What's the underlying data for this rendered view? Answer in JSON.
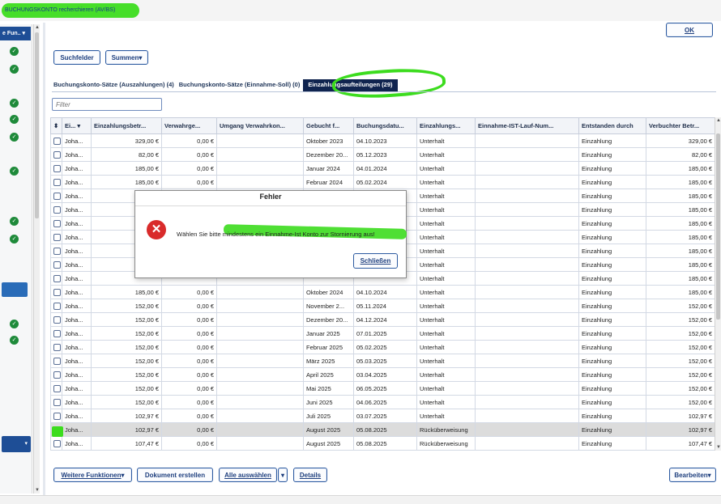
{
  "window": {
    "title": "BUCHUNGSKONTO recherchieren (AV/BS)"
  },
  "left_panel": {
    "header_label": "e Fun.."
  },
  "toolbar": {
    "ok_label": "OK",
    "suchfelder_label": "Suchfelder",
    "summen_label": "Summen"
  },
  "tabs": [
    {
      "label": "Buchungskonto-Sätze (Auszahlungen) (4)"
    },
    {
      "label": "Buchungskonto-Sätze (Einnahme-Soll) (0)"
    },
    {
      "label": "Einzahlungsaufteilungen (29)"
    }
  ],
  "filter": {
    "placeholder": "Filter"
  },
  "table": {
    "columns": [
      "Ei...",
      "Einzahlungsbetr...",
      "Verwahrge...",
      "Umgang Verwahrkon...",
      "Gebucht f...",
      "Buchungsdatu...",
      "Einzahlungs...",
      "Einnahme-IST-Lauf-Num...",
      "Entstanden durch",
      "Verbuchter Betr..."
    ],
    "rows": [
      {
        "checked": false,
        "name": "Joha...",
        "betrag": "329,00 €",
        "verwahr": "0,00 €",
        "umgang": "",
        "gebucht": "Oktober 2023",
        "buchung": "04.10.2023",
        "art": "Unterhalt",
        "lauf": "",
        "entstanden": "Einzahlung",
        "verbucht": "329,00 €"
      },
      {
        "checked": false,
        "name": "Joha...",
        "betrag": "82,00 €",
        "verwahr": "0,00 €",
        "umgang": "",
        "gebucht": "Dezember 20...",
        "buchung": "05.12.2023",
        "art": "Unterhalt",
        "lauf": "",
        "entstanden": "Einzahlung",
        "verbucht": "82,00 €"
      },
      {
        "checked": false,
        "name": "Joha...",
        "betrag": "185,00 €",
        "verwahr": "0,00 €",
        "umgang": "",
        "gebucht": "Januar 2024",
        "buchung": "04.01.2024",
        "art": "Unterhalt",
        "lauf": "",
        "entstanden": "Einzahlung",
        "verbucht": "185,00 €"
      },
      {
        "checked": false,
        "name": "Joha...",
        "betrag": "185,00 €",
        "verwahr": "0,00 €",
        "umgang": "",
        "gebucht": "Februar 2024",
        "buchung": "05.02.2024",
        "art": "Unterhalt",
        "lauf": "",
        "entstanden": "Einzahlung",
        "verbucht": "185,00 €"
      },
      {
        "checked": false,
        "name": "Joha...",
        "betrag": "",
        "verwahr": "",
        "umgang": "",
        "gebucht": "",
        "buchung": "",
        "art": "Unterhalt",
        "lauf": "",
        "entstanden": "Einzahlung",
        "verbucht": "185,00 €"
      },
      {
        "checked": false,
        "name": "Joha...",
        "betrag": "",
        "verwahr": "",
        "umgang": "",
        "gebucht": "",
        "buchung": "",
        "art": "Unterhalt",
        "lauf": "",
        "entstanden": "Einzahlung",
        "verbucht": "185,00 €"
      },
      {
        "checked": false,
        "name": "Joha...",
        "betrag": "",
        "verwahr": "",
        "umgang": "",
        "gebucht": "",
        "buchung": "",
        "art": "Unterhalt",
        "lauf": "",
        "entstanden": "Einzahlung",
        "verbucht": "185,00 €"
      },
      {
        "checked": false,
        "name": "Joha...",
        "betrag": "",
        "verwahr": "",
        "umgang": "",
        "gebucht": "",
        "buchung": "",
        "art": "Unterhalt",
        "lauf": "",
        "entstanden": "Einzahlung",
        "verbucht": "185,00 €"
      },
      {
        "checked": false,
        "name": "Joha...",
        "betrag": "",
        "verwahr": "",
        "umgang": "",
        "gebucht": "",
        "buchung": "",
        "art": "Unterhalt",
        "lauf": "",
        "entstanden": "Einzahlung",
        "verbucht": "185,00 €"
      },
      {
        "checked": false,
        "name": "Joha...",
        "betrag": "",
        "verwahr": "",
        "umgang": "",
        "gebucht": "",
        "buchung": "",
        "art": "Unterhalt",
        "lauf": "",
        "entstanden": "Einzahlung",
        "verbucht": "185,00 €"
      },
      {
        "checked": false,
        "name": "Joha...",
        "betrag": "",
        "verwahr": "",
        "umgang": "",
        "gebucht": "",
        "buchung": "",
        "art": "Unterhalt",
        "lauf": "",
        "entstanden": "Einzahlung",
        "verbucht": "185,00 €"
      },
      {
        "checked": false,
        "name": "Joha...",
        "betrag": "185,00 €",
        "verwahr": "0,00 €",
        "umgang": "",
        "gebucht": "Oktober 2024",
        "buchung": "04.10.2024",
        "art": "Unterhalt",
        "lauf": "",
        "entstanden": "Einzahlung",
        "verbucht": "185,00 €"
      },
      {
        "checked": false,
        "name": "Joha...",
        "betrag": "152,00 €",
        "verwahr": "0,00 €",
        "umgang": "",
        "gebucht": "November 2...",
        "buchung": "05.11.2024",
        "art": "Unterhalt",
        "lauf": "",
        "entstanden": "Einzahlung",
        "verbucht": "152,00 €"
      },
      {
        "checked": false,
        "name": "Joha...",
        "betrag": "152,00 €",
        "verwahr": "0,00 €",
        "umgang": "",
        "gebucht": "Dezember 20...",
        "buchung": "04.12.2024",
        "art": "Unterhalt",
        "lauf": "",
        "entstanden": "Einzahlung",
        "verbucht": "152,00 €"
      },
      {
        "checked": false,
        "name": "Joha...",
        "betrag": "152,00 €",
        "verwahr": "0,00 €",
        "umgang": "",
        "gebucht": "Januar 2025",
        "buchung": "07.01.2025",
        "art": "Unterhalt",
        "lauf": "",
        "entstanden": "Einzahlung",
        "verbucht": "152,00 €"
      },
      {
        "checked": false,
        "name": "Joha...",
        "betrag": "152,00 €",
        "verwahr": "0,00 €",
        "umgang": "",
        "gebucht": "Februar 2025",
        "buchung": "05.02.2025",
        "art": "Unterhalt",
        "lauf": "",
        "entstanden": "Einzahlung",
        "verbucht": "152,00 €"
      },
      {
        "checked": false,
        "name": "Joha...",
        "betrag": "152,00 €",
        "verwahr": "0,00 €",
        "umgang": "",
        "gebucht": "März 2025",
        "buchung": "05.03.2025",
        "art": "Unterhalt",
        "lauf": "",
        "entstanden": "Einzahlung",
        "verbucht": "152,00 €"
      },
      {
        "checked": false,
        "name": "Joha...",
        "betrag": "152,00 €",
        "verwahr": "0,00 €",
        "umgang": "",
        "gebucht": "April 2025",
        "buchung": "03.04.2025",
        "art": "Unterhalt",
        "lauf": "",
        "entstanden": "Einzahlung",
        "verbucht": "152,00 €"
      },
      {
        "checked": false,
        "name": "Joha...",
        "betrag": "152,00 €",
        "verwahr": "0,00 €",
        "umgang": "",
        "gebucht": "Mai 2025",
        "buchung": "06.05.2025",
        "art": "Unterhalt",
        "lauf": "",
        "entstanden": "Einzahlung",
        "verbucht": "152,00 €"
      },
      {
        "checked": false,
        "name": "Joha...",
        "betrag": "152,00 €",
        "verwahr": "0,00 €",
        "umgang": "",
        "gebucht": "Juni 2025",
        "buchung": "04.06.2025",
        "art": "Unterhalt",
        "lauf": "",
        "entstanden": "Einzahlung",
        "verbucht": "152,00 €"
      },
      {
        "checked": false,
        "name": "Joha...",
        "betrag": "102,97 €",
        "verwahr": "0,00 €",
        "umgang": "",
        "gebucht": "Juli 2025",
        "buchung": "03.07.2025",
        "art": "Unterhalt",
        "lauf": "",
        "entstanden": "Einzahlung",
        "verbucht": "102,97 €"
      },
      {
        "checked": true,
        "name": "Joha...",
        "betrag": "102,97 €",
        "verwahr": "0,00 €",
        "umgang": "",
        "gebucht": "August 2025",
        "buchung": "05.08.2025",
        "art": "Rücküberweisung",
        "lauf": "",
        "entstanden": "Einzahlung",
        "verbucht": "102,97 €"
      },
      {
        "checked": false,
        "name": "Joha...",
        "betrag": "107,47 €",
        "verwahr": "0,00 €",
        "umgang": "",
        "gebucht": "August 2025",
        "buchung": "05.08.2025",
        "art": "Rücküberweisung",
        "lauf": "",
        "entstanden": "Einzahlung",
        "verbucht": "107,47 €"
      }
    ]
  },
  "dialog": {
    "title": "Fehler",
    "message": "Wählen Sie bitte mindestens ein Einnahme-Ist Konto zur Stornierung aus!",
    "close_label": "Schließen"
  },
  "bottom_toolbar": {
    "weitere_label": "Weitere Funktionen",
    "dokument_label": "Dokument erstellen",
    "alle_label": "Alle auswählen",
    "details_label": "Details",
    "bearbeiten_label": "Bearbeiten"
  },
  "colors": {
    "accent": "#1e4e96",
    "highlight": "#3cdc1e",
    "error": "#d92b2b",
    "tab_active": "#10244f"
  }
}
